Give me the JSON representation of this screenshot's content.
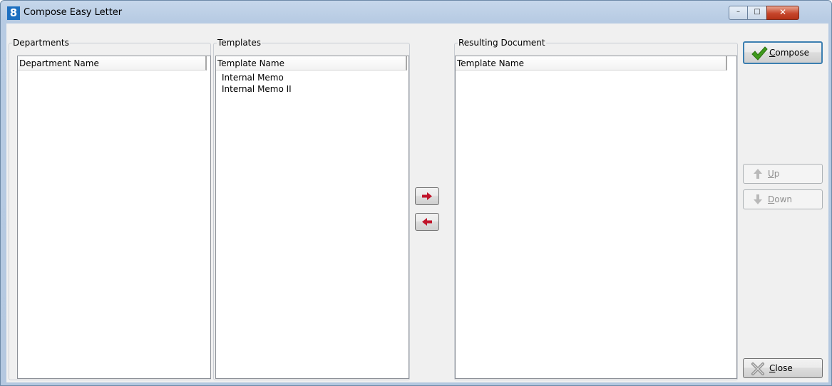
{
  "window": {
    "title": "Compose Easy Letter",
    "app_icon_glyph": "8",
    "controls": {
      "minimize": "–",
      "maximize": "□",
      "close": "✕"
    }
  },
  "departments": {
    "group_label": "Departments",
    "column_header": "Department Name",
    "items": []
  },
  "templates": {
    "group_label": "Templates",
    "column_header": "Template Name",
    "items": [
      "Internal Memo",
      "Internal Memo II"
    ]
  },
  "resulting": {
    "group_label": "Resulting Document",
    "column_header": "Template Name",
    "items": []
  },
  "transfer": {
    "add_icon": "arrow-right-icon",
    "remove_icon": "arrow-left-icon",
    "arrow_color": "#c0142a"
  },
  "buttons": {
    "compose": {
      "label_first": "C",
      "label_rest": "ompose",
      "icon": "checkmark-icon",
      "icon_color": "#3f9a1c"
    },
    "up": {
      "label_first": "U",
      "label_rest": "p",
      "icon": "arrow-up-icon",
      "enabled": false
    },
    "down": {
      "label_first": "D",
      "label_rest": "own",
      "icon": "arrow-down-icon",
      "enabled": false
    },
    "close": {
      "label_first": "C",
      "label_rest": "lose",
      "icon": "close-x-icon"
    }
  }
}
